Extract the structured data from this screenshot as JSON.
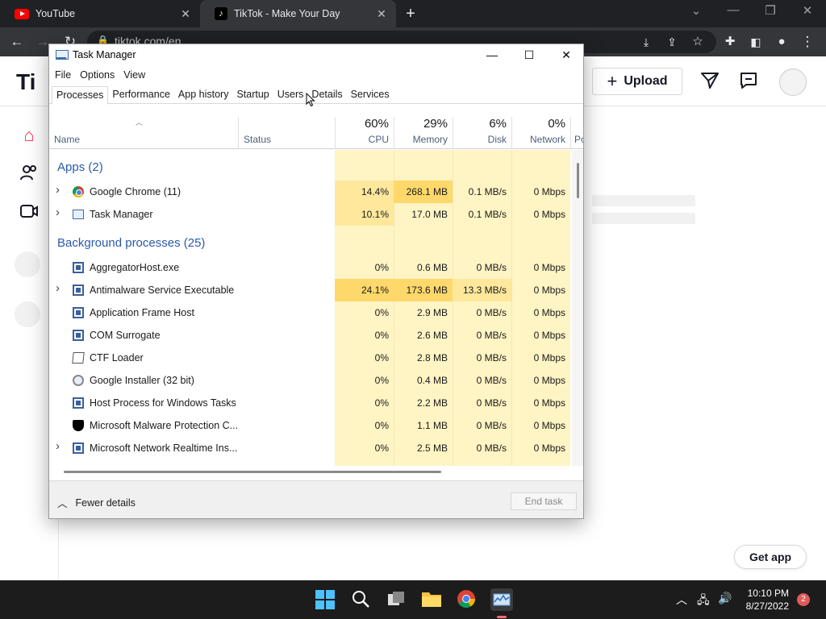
{
  "browser": {
    "tabs": [
      {
        "label": "YouTube",
        "icon": "youtube-icon",
        "active": false
      },
      {
        "label": "TikTok - Make Your Day",
        "icon": "tiktok-icon",
        "active": true
      }
    ],
    "address": "tiktok.com/en"
  },
  "tiktok": {
    "logo_text": "Ti",
    "upload_label": "Upload",
    "get_app_label": "Get app"
  },
  "taskmanager": {
    "title": "Task Manager",
    "menu": [
      "File",
      "Options",
      "View"
    ],
    "tabs": [
      "Processes",
      "Performance",
      "App history",
      "Startup",
      "Users",
      "Details",
      "Services"
    ],
    "selected_tab": "Processes",
    "columns": {
      "name": "Name",
      "status": "Status",
      "cpu": {
        "pct": "60%",
        "label": "CPU"
      },
      "memory": {
        "pct": "29%",
        "label": "Memory"
      },
      "disk": {
        "pct": "6%",
        "label": "Disk"
      },
      "network": {
        "pct": "0%",
        "label": "Network"
      },
      "power": "Po"
    },
    "groups": {
      "apps": "Apps (2)",
      "background": "Background processes (25)"
    },
    "apps": [
      {
        "name": "Google Chrome (11)",
        "icon": "chrome-icon",
        "expandable": true,
        "cpu": "14.4%",
        "memory": "268.1 MB",
        "disk": "0.1 MB/s",
        "network": "0 Mbps"
      },
      {
        "name": "Task Manager",
        "icon": "task-manager-icon",
        "expandable": true,
        "cpu": "10.1%",
        "memory": "17.0 MB",
        "disk": "0.1 MB/s",
        "network": "0 Mbps"
      }
    ],
    "background": [
      {
        "name": "AggregatorHost.exe",
        "icon": "window-icon",
        "expandable": false,
        "cpu": "0%",
        "memory": "0.6 MB",
        "disk": "0 MB/s",
        "network": "0 Mbps"
      },
      {
        "name": "Antimalware Service Executable",
        "icon": "window-icon",
        "expandable": true,
        "cpu": "24.1%",
        "memory": "173.6 MB",
        "disk": "13.3 MB/s",
        "network": "0 Mbps"
      },
      {
        "name": "Application Frame Host",
        "icon": "window-icon",
        "expandable": false,
        "cpu": "0%",
        "memory": "2.9 MB",
        "disk": "0 MB/s",
        "network": "0 Mbps"
      },
      {
        "name": "COM Surrogate",
        "icon": "window-icon",
        "expandable": false,
        "cpu": "0%",
        "memory": "2.6 MB",
        "disk": "0 MB/s",
        "network": "0 Mbps"
      },
      {
        "name": "CTF Loader",
        "icon": "ctf-icon",
        "expandable": false,
        "cpu": "0%",
        "memory": "2.8 MB",
        "disk": "0 MB/s",
        "network": "0 Mbps"
      },
      {
        "name": "Google Installer (32 bit)",
        "icon": "installer-icon",
        "expandable": false,
        "cpu": "0%",
        "memory": "0.4 MB",
        "disk": "0 MB/s",
        "network": "0 Mbps"
      },
      {
        "name": "Host Process for Windows Tasks",
        "icon": "window-icon",
        "expandable": false,
        "cpu": "0%",
        "memory": "2.2 MB",
        "disk": "0 MB/s",
        "network": "0 Mbps"
      },
      {
        "name": "Microsoft Malware Protection C...",
        "icon": "shield-icon",
        "expandable": false,
        "cpu": "0%",
        "memory": "1.1 MB",
        "disk": "0 MB/s",
        "network": "0 Mbps"
      },
      {
        "name": "Microsoft Network Realtime Ins...",
        "icon": "window-icon",
        "expandable": true,
        "cpu": "0%",
        "memory": "2.5 MB",
        "disk": "0 MB/s",
        "network": "0 Mbps"
      }
    ],
    "fewer_details": "Fewer details",
    "end_task": "End task"
  },
  "taskbar": {
    "time": "10:10 PM",
    "date": "8/27/2022",
    "notifications": "2"
  },
  "colors": {
    "heat_low": "#fff4c4",
    "heat_mid": "#ffe89c",
    "heat_high": "#ffd86b",
    "group_text": "#2a5aa6"
  }
}
